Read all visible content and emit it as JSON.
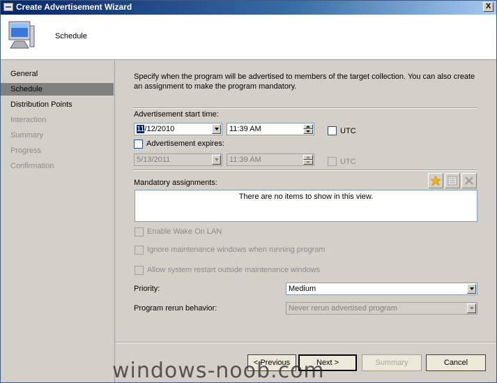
{
  "window": {
    "title": "Create Advertisement Wizard",
    "close_label": "X"
  },
  "header": {
    "title": "Schedule",
    "icon": "computer-monitor-icon"
  },
  "sidebar": {
    "items": [
      {
        "label": "General",
        "state": "normal"
      },
      {
        "label": "Schedule",
        "state": "active"
      },
      {
        "label": "Distribution Points",
        "state": "normal"
      },
      {
        "label": "Interaction",
        "state": "disabled"
      },
      {
        "label": "Summary",
        "state": "disabled"
      },
      {
        "label": "Progress",
        "state": "disabled"
      },
      {
        "label": "Confirmation",
        "state": "disabled"
      }
    ]
  },
  "main": {
    "description": "Specify when the program will be advertised to members of the target collection. You can also create an assignment to make the program mandatory.",
    "start_time": {
      "label": "Advertisement start time:",
      "date_selected_part": "11",
      "date_rest": "/12/2010",
      "time": "11:39 AM",
      "utc_label": "UTC",
      "utc_checked": false
    },
    "expires": {
      "label": "Advertisement expires:",
      "checked": false,
      "date": "5/13/2011",
      "time": "11:39 AM",
      "utc_label": "UTC"
    },
    "mandatory": {
      "label": "Mandatory assignments:",
      "empty_text": "There are no items to show in this view.",
      "toolbar": {
        "new_icon": "new-star-icon",
        "properties_icon": "properties-icon",
        "delete_icon": "delete-x-icon"
      }
    },
    "options": {
      "wake_on_lan": "Enable Wake On LAN",
      "ignore_maintenance": "Ignore maintenance windows when running program",
      "allow_restart": "Allow system restart outside maintenance windows"
    },
    "priority": {
      "label": "Priority:",
      "value": "Medium"
    },
    "rerun": {
      "label": "Program rerun behavior:",
      "value": "Never rerun advertised program"
    }
  },
  "buttons": {
    "previous": "< Previous",
    "next": "Next >",
    "summary": "Summary",
    "cancel": "Cancel"
  },
  "watermark": "windows-noob.com"
}
